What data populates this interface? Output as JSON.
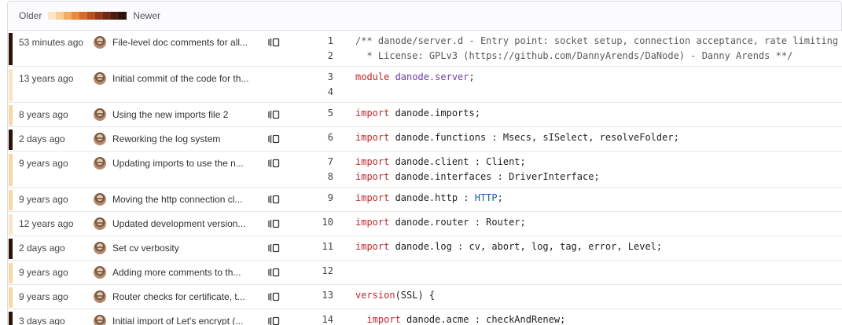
{
  "legend": {
    "older_label": "Older",
    "newer_label": "Newer",
    "colors": [
      "#fde7c7",
      "#f9cf95",
      "#f3ad60",
      "#e88b3c",
      "#d56a2b",
      "#b94f20",
      "#93391a",
      "#6b2a16",
      "#4a1d10",
      "#2e120a"
    ]
  },
  "rows": [
    {
      "age": "53 minutes ago",
      "message": "File-level doc comments for all...",
      "bar_color": "#2e120a",
      "show_icon": true,
      "lines": [
        {
          "no": "1",
          "tokens": [
            {
              "t": "/** danode/server.d - Entry point: socket setup, connection acceptance, rate limiting",
              "c": "cm"
            }
          ]
        },
        {
          "no": "2",
          "tokens": [
            {
              "t": "  * License: GPLv3 (https://github.com/DannyArends/DaNode) - Danny Arends **/",
              "c": "cm"
            }
          ]
        }
      ]
    },
    {
      "age": "13 years ago",
      "message": "Initial commit of the code for th...",
      "bar_color": "#fbe3c3",
      "show_icon": false,
      "lines": [
        {
          "no": "3",
          "tokens": [
            {
              "t": "module ",
              "c": "kw"
            },
            {
              "t": "danode.server",
              "c": "nm"
            },
            {
              "t": ";",
              "c": ""
            }
          ]
        },
        {
          "no": "4",
          "tokens": []
        }
      ]
    },
    {
      "age": "8 years ago",
      "message": "Using the new imports file 2",
      "bar_color": "#f9d6a6",
      "show_icon": true,
      "lines": [
        {
          "no": "5",
          "tokens": [
            {
              "t": "import ",
              "c": "kw"
            },
            {
              "t": "danode.imports;",
              "c": ""
            }
          ]
        }
      ]
    },
    {
      "age": "2 days ago",
      "message": "Reworking the log system",
      "bar_color": "#2e120a",
      "show_icon": true,
      "lines": [
        {
          "no": "6",
          "tokens": [
            {
              "t": "import ",
              "c": "kw"
            },
            {
              "t": "danode.functions : Msecs, sISelect, resolveFolder;",
              "c": ""
            }
          ]
        }
      ]
    },
    {
      "age": "9 years ago",
      "message": "Updating imports to use the n...",
      "bar_color": "#f9d6a6",
      "show_icon": true,
      "lines": [
        {
          "no": "7",
          "tokens": [
            {
              "t": "import ",
              "c": "kw"
            },
            {
              "t": "danode.client : Client;",
              "c": ""
            }
          ]
        },
        {
          "no": "8",
          "tokens": [
            {
              "t": "import ",
              "c": "kw"
            },
            {
              "t": "danode.interfaces : DriverInterface;",
              "c": ""
            }
          ]
        }
      ]
    },
    {
      "age": "9 years ago",
      "message": "Moving the http connection cl...",
      "bar_color": "#f9d6a6",
      "show_icon": true,
      "lines": [
        {
          "no": "9",
          "tokens": [
            {
              "t": "import ",
              "c": "kw"
            },
            {
              "t": "danode.http : ",
              "c": ""
            },
            {
              "t": "HTTP",
              "c": "ty"
            },
            {
              "t": ";",
              "c": ""
            }
          ]
        }
      ]
    },
    {
      "age": "12 years ago",
      "message": "Updated development version...",
      "bar_color": "#fbe3c3",
      "show_icon": true,
      "lines": [
        {
          "no": "10",
          "tokens": [
            {
              "t": "import ",
              "c": "kw"
            },
            {
              "t": "danode.router : Router;",
              "c": ""
            }
          ]
        }
      ]
    },
    {
      "age": "2 days ago",
      "message": "Set cv verbosity",
      "bar_color": "#2e120a",
      "show_icon": true,
      "lines": [
        {
          "no": "11",
          "tokens": [
            {
              "t": "import ",
              "c": "kw"
            },
            {
              "t": "danode.log : cv, abort, log, tag, error, Level;",
              "c": ""
            }
          ]
        }
      ]
    },
    {
      "age": "9 years ago",
      "message": "Adding more comments to th...",
      "bar_color": "#f9d6a6",
      "show_icon": true,
      "lines": [
        {
          "no": "12",
          "tokens": []
        }
      ]
    },
    {
      "age": "9 years ago",
      "message": "Router checks for certificate, t...",
      "bar_color": "#f9d6a6",
      "show_icon": true,
      "lines": [
        {
          "no": "13",
          "tokens": [
            {
              "t": "version",
              "c": "kw"
            },
            {
              "t": "(SSL) {",
              "c": ""
            }
          ]
        }
      ]
    },
    {
      "age": "3 days ago",
      "message": "Initial import of Let's encrypt (...",
      "bar_color": "#2e120a",
      "show_icon": true,
      "lines": [
        {
          "no": "14",
          "tokens": [
            {
              "t": "  import ",
              "c": "kw"
            },
            {
              "t": "danode.acme : checkAndRenew;",
              "c": ""
            }
          ]
        }
      ]
    }
  ]
}
